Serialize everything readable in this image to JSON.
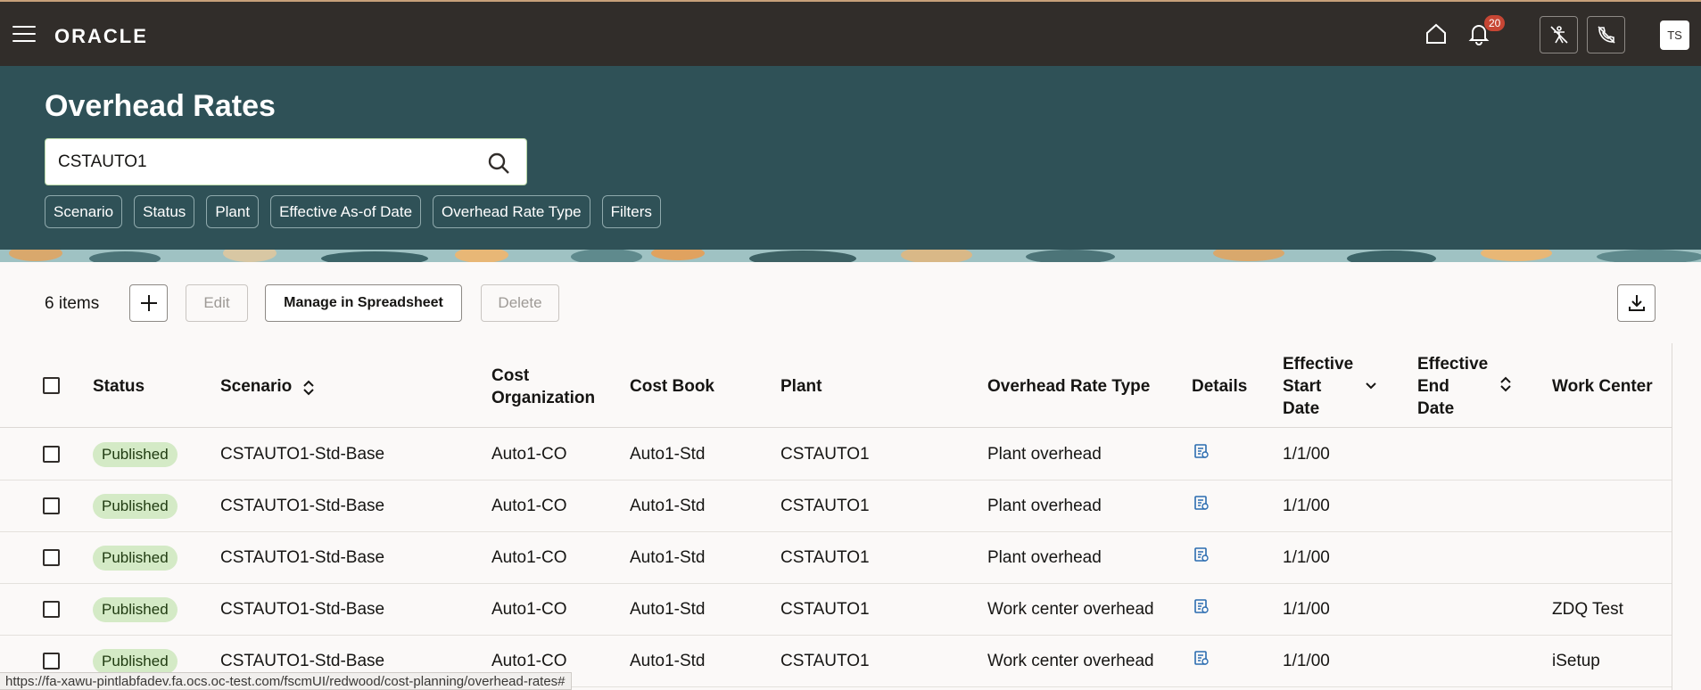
{
  "app": {
    "logo": "ORACLE",
    "notification_count": "20",
    "avatar_initials": "TS"
  },
  "page": {
    "title": "Overhead Rates",
    "search": {
      "value": "CSTAUTO1"
    },
    "filter_chips": [
      "Scenario",
      "Status",
      "Plant",
      "Effective As-of Date",
      "Overhead Rate Type",
      "Filters"
    ]
  },
  "toolbar": {
    "item_count": "6 items",
    "edit_label": "Edit",
    "manage_label": "Manage in Spreadsheet",
    "delete_label": "Delete"
  },
  "table": {
    "columns": {
      "status": "Status",
      "scenario": "Scenario",
      "cost_org_1": "Cost",
      "cost_org_2": "Organization",
      "cost_book": "Cost Book",
      "plant": "Plant",
      "rate_type": "Overhead Rate Type",
      "details": "Details",
      "eff_start_1": "Effective",
      "eff_start_2": "Start",
      "eff_start_3": "Date",
      "eff_end_1": "Effective",
      "eff_end_2": "End",
      "eff_end_3": "Date",
      "work_center": "Work Center"
    },
    "rows": [
      {
        "status": "Published",
        "scenario": "CSTAUTO1-Std-Base",
        "cost_org": "Auto1-CO",
        "cost_book": "Auto1-Std",
        "plant": "CSTAUTO1",
        "rate_type": "Plant overhead",
        "eff_start": "1/1/00",
        "eff_end": "",
        "work_center": ""
      },
      {
        "status": "Published",
        "scenario": "CSTAUTO1-Std-Base",
        "cost_org": "Auto1-CO",
        "cost_book": "Auto1-Std",
        "plant": "CSTAUTO1",
        "rate_type": "Plant overhead",
        "eff_start": "1/1/00",
        "eff_end": "",
        "work_center": ""
      },
      {
        "status": "Published",
        "scenario": "CSTAUTO1-Std-Base",
        "cost_org": "Auto1-CO",
        "cost_book": "Auto1-Std",
        "plant": "CSTAUTO1",
        "rate_type": "Plant overhead",
        "eff_start": "1/1/00",
        "eff_end": "",
        "work_center": ""
      },
      {
        "status": "Published",
        "scenario": "CSTAUTO1-Std-Base",
        "cost_org": "Auto1-CO",
        "cost_book": "Auto1-Std",
        "plant": "CSTAUTO1",
        "rate_type": "Work center overhead",
        "eff_start": "1/1/00",
        "eff_end": "",
        "work_center": "ZDQ Test"
      },
      {
        "status": "Published",
        "scenario": "CSTAUTO1-Std-Base",
        "cost_org": "Auto1-CO",
        "cost_book": "Auto1-Std",
        "plant": "CSTAUTO1",
        "rate_type": "Work center overhead",
        "eff_start": "1/1/00",
        "eff_end": "",
        "work_center": "iSetup"
      }
    ]
  },
  "status_bar": {
    "url": "https://fa-xawu-pintlabfadev.fa.ocs.oc-test.com/fscmUI/redwood/cost-planning/overhead-rates#"
  },
  "colors": {
    "topbar": "#312d2a",
    "header": "#2f5157",
    "badge_bg": "#d4eac6",
    "notification": "#c74634"
  }
}
